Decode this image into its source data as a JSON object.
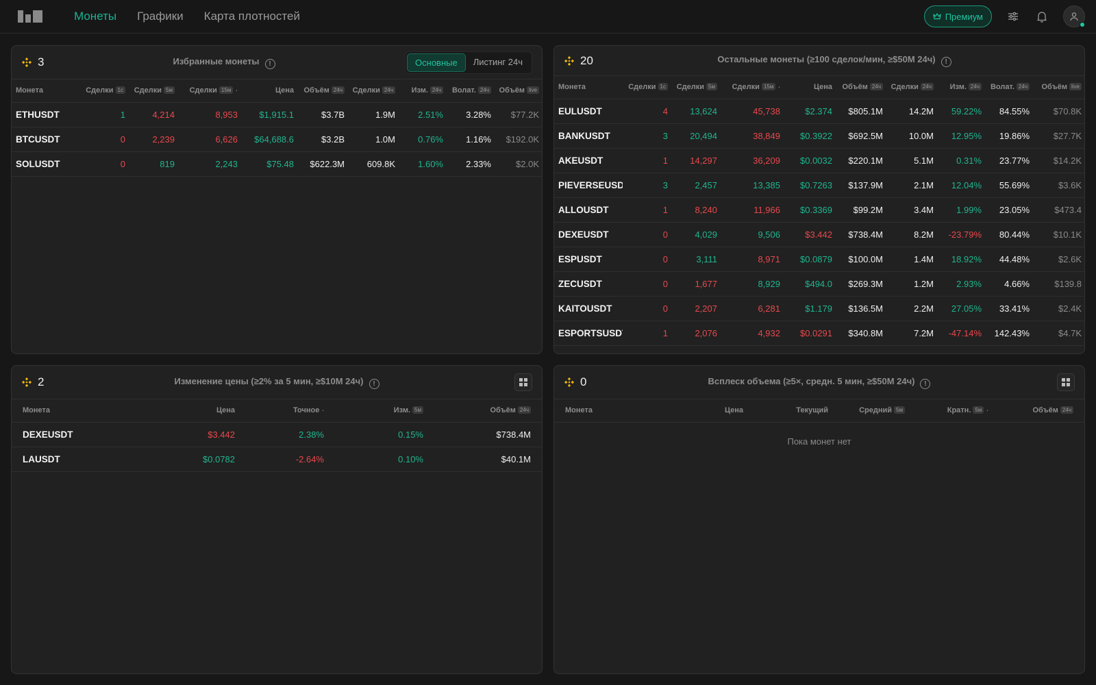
{
  "nav": {
    "items": [
      "Монеты",
      "Графики",
      "Карта плотностей"
    ],
    "active": 0,
    "premium": "Премиум"
  },
  "colors": {
    "accent": "#19b394",
    "positive": "#20b58f",
    "negative": "#e8484d",
    "bnb": "#f0b90b"
  },
  "favorites": {
    "count": "3",
    "title": "Избранные монеты",
    "tabs": [
      "Основные",
      "Листинг 24ч"
    ],
    "columns": [
      {
        "label": "Монета",
        "tag": ""
      },
      {
        "label": "Сделки",
        "tag": "1с"
      },
      {
        "label": "Сделки",
        "tag": "5м"
      },
      {
        "label": "Сделки",
        "tag": "15м",
        "sort": "·"
      },
      {
        "label": "Цена",
        "tag": ""
      },
      {
        "label": "Объём",
        "tag": "24ч"
      },
      {
        "label": "Сделки",
        "tag": "24ч"
      },
      {
        "label": "Изм.",
        "tag": "24ч"
      },
      {
        "label": "Волат.",
        "tag": "24ч"
      },
      {
        "label": "Объём",
        "tag": "live"
      }
    ],
    "rows": [
      {
        "cells": [
          "ETHUSDT",
          "1",
          "4,214",
          "8,953",
          "$1,915.1",
          "$3.7B",
          "1.9M",
          "2.51%",
          "3.28%",
          "$77.2K"
        ],
        "colors": [
          "sym",
          "g",
          "r",
          "r",
          "g",
          "w",
          "w",
          "g",
          "w",
          "m"
        ]
      },
      {
        "cells": [
          "BTCUSDT",
          "0",
          "2,239",
          "6,626",
          "$64,688.6",
          "$3.2B",
          "1.0M",
          "0.76%",
          "1.16%",
          "$192.0K"
        ],
        "colors": [
          "sym",
          "r",
          "r",
          "r",
          "g",
          "w",
          "w",
          "g",
          "w",
          "m"
        ]
      },
      {
        "cells": [
          "SOLUSDT",
          "0",
          "819",
          "2,243",
          "$75.48",
          "$622.3M",
          "609.8K",
          "1.60%",
          "2.33%",
          "$2.0K"
        ],
        "colors": [
          "sym",
          "r",
          "g",
          "g",
          "g",
          "w",
          "w",
          "g",
          "w",
          "m"
        ]
      }
    ]
  },
  "others": {
    "count": "20",
    "title": "Остальные монеты (≥100 сделок/мин, ≥$50M 24ч)",
    "columns": [
      {
        "label": "Монета",
        "tag": ""
      },
      {
        "label": "Сделки",
        "tag": "1с"
      },
      {
        "label": "Сделки",
        "tag": "5м"
      },
      {
        "label": "Сделки",
        "tag": "15м",
        "sort": "·"
      },
      {
        "label": "Цена",
        "tag": ""
      },
      {
        "label": "Объём",
        "tag": "24ч"
      },
      {
        "label": "Сделки",
        "tag": "24ч"
      },
      {
        "label": "Изм.",
        "tag": "24ч"
      },
      {
        "label": "Волат.",
        "tag": "24ч"
      },
      {
        "label": "Объём",
        "tag": "live"
      }
    ],
    "rows": [
      {
        "cells": [
          "EULUSDT",
          "4",
          "13,624",
          "45,738",
          "$2.374",
          "$805.1M",
          "14.2M",
          "59.22%",
          "84.55%",
          "$70.8K"
        ],
        "colors": [
          "sym",
          "r",
          "g",
          "r",
          "g",
          "w",
          "w",
          "g",
          "w",
          "m"
        ]
      },
      {
        "cells": [
          "BANKUSDT",
          "3",
          "20,494",
          "38,849",
          "$0.3922",
          "$692.5M",
          "10.0M",
          "12.95%",
          "19.86%",
          "$27.7K"
        ],
        "colors": [
          "sym",
          "g",
          "g",
          "r",
          "g",
          "w",
          "w",
          "g",
          "w",
          "m"
        ]
      },
      {
        "cells": [
          "AKEUSDT",
          "1",
          "14,297",
          "36,209",
          "$0.0032",
          "$220.1M",
          "5.1M",
          "0.31%",
          "23.77%",
          "$14.2K"
        ],
        "colors": [
          "sym",
          "r",
          "r",
          "r",
          "g",
          "w",
          "w",
          "g",
          "w",
          "m"
        ]
      },
      {
        "cells": [
          "PIEVERSEUSDT",
          "3",
          "2,457",
          "13,385",
          "$0.7263",
          "$137.9M",
          "2.1M",
          "12.04%",
          "55.69%",
          "$3.6K"
        ],
        "colors": [
          "sym",
          "g",
          "g",
          "g",
          "g",
          "w",
          "w",
          "g",
          "w",
          "m"
        ]
      },
      {
        "cells": [
          "ALLOUSDT",
          "1",
          "8,240",
          "11,966",
          "$0.3369",
          "$99.2M",
          "3.4M",
          "1.99%",
          "23.05%",
          "$473.4"
        ],
        "colors": [
          "sym",
          "r",
          "r",
          "r",
          "g",
          "w",
          "w",
          "g",
          "w",
          "m"
        ]
      },
      {
        "cells": [
          "DEXEUSDT",
          "0",
          "4,029",
          "9,506",
          "$3.442",
          "$738.4M",
          "8.2M",
          "-23.79%",
          "80.44%",
          "$10.1K"
        ],
        "colors": [
          "sym",
          "r",
          "g",
          "g",
          "r",
          "w",
          "w",
          "r",
          "w",
          "m"
        ]
      },
      {
        "cells": [
          "ESPUSDT",
          "0",
          "3,111",
          "8,971",
          "$0.0879",
          "$100.0M",
          "1.4M",
          "18.92%",
          "44.48%",
          "$2.6K"
        ],
        "colors": [
          "sym",
          "r",
          "g",
          "r",
          "g",
          "w",
          "w",
          "g",
          "w",
          "m"
        ]
      },
      {
        "cells": [
          "ZECUSDT",
          "0",
          "1,677",
          "8,929",
          "$494.0",
          "$269.3M",
          "1.2M",
          "2.93%",
          "4.66%",
          "$139.8"
        ],
        "colors": [
          "sym",
          "r",
          "r",
          "g",
          "g",
          "w",
          "w",
          "g",
          "w",
          "m"
        ]
      },
      {
        "cells": [
          "KAITOUSDT",
          "0",
          "2,207",
          "6,281",
          "$1.179",
          "$136.5M",
          "2.2M",
          "27.05%",
          "33.41%",
          "$2.4K"
        ],
        "colors": [
          "sym",
          "r",
          "r",
          "r",
          "g",
          "w",
          "w",
          "g",
          "w",
          "m"
        ]
      },
      {
        "cells": [
          "ESPORTSUSDT",
          "1",
          "2,076",
          "4,932",
          "$0.0291",
          "$340.8M",
          "7.2M",
          "-47.14%",
          "142.43%",
          "$4.7K"
        ],
        "colors": [
          "sym",
          "r",
          "r",
          "r",
          "r",
          "w",
          "w",
          "r",
          "w",
          "m"
        ]
      }
    ]
  },
  "price_change": {
    "count": "2",
    "title": "Изменение цены (≥2% за 5 мин, ≥$10M 24ч)",
    "columns": [
      {
        "label": "Монета",
        "tag": ""
      },
      {
        "label": "Цена",
        "tag": ""
      },
      {
        "label": "Точное",
        "tag": "",
        "sort": "·"
      },
      {
        "label": "Изм.",
        "tag": "5м"
      },
      {
        "label": "Объём",
        "tag": "24ч"
      }
    ],
    "rows": [
      {
        "cells": [
          "DEXEUSDT",
          "$3.442",
          "2.38%",
          "0.15%",
          "$738.4M"
        ],
        "colors": [
          "sym",
          "r",
          "g",
          "g",
          "w"
        ]
      },
      {
        "cells": [
          "LAUSDT",
          "$0.0782",
          "-2.64%",
          "0.10%",
          "$40.1M"
        ],
        "colors": [
          "sym",
          "g",
          "r",
          "g",
          "w"
        ]
      }
    ]
  },
  "volume_spike": {
    "count": "0",
    "title": "Всплеск объема (≥5×, средн. 5 мин, ≥$50M 24ч)",
    "columns": [
      {
        "label": "Монета",
        "tag": ""
      },
      {
        "label": "Цена",
        "tag": ""
      },
      {
        "label": "Текущий",
        "tag": ""
      },
      {
        "label": "Средний",
        "tag": "5м"
      },
      {
        "label": "Кратн.",
        "tag": "5м",
        "sort": "·"
      },
      {
        "label": "Объём",
        "tag": "24ч"
      }
    ],
    "rows": [],
    "empty_text": "Пока монет нет"
  }
}
